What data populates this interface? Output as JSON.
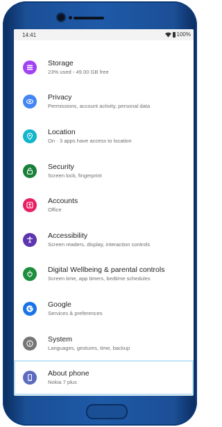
{
  "status_bar": {
    "time": "14:41",
    "battery": "100%"
  },
  "settings": {
    "items": [
      {
        "title": "Storage",
        "subtitle": "23% used - 49.00 GB free",
        "icon": "storage-icon",
        "color": "#a142f4"
      },
      {
        "title": "Privacy",
        "subtitle": "Permissions, account activity, personal data",
        "icon": "privacy-icon",
        "color": "#4285f4"
      },
      {
        "title": "Location",
        "subtitle": "On · 3 apps have access to location",
        "icon": "location-icon",
        "color": "#12b5cb"
      },
      {
        "title": "Security",
        "subtitle": "Screen lock, fingerprint",
        "icon": "lock-icon",
        "color": "#188038"
      },
      {
        "title": "Accounts",
        "subtitle": "Office",
        "icon": "accounts-icon",
        "color": "#e91e63"
      },
      {
        "title": "Accessibility",
        "subtitle": "Screen readers, display, interaction controls",
        "icon": "accessibility-icon",
        "color": "#5e35b1"
      },
      {
        "title": "Digital Wellbeing & parental controls",
        "subtitle": "Screen time, app timers, bedtime schedules",
        "icon": "wellbeing-icon",
        "color": "#1e8e3e"
      },
      {
        "title": "Google",
        "subtitle": "Services & preferences",
        "icon": "google-icon",
        "color": "#1a73e8"
      },
      {
        "title": "System",
        "subtitle": "Languages, gestures, time, backup",
        "icon": "info-icon",
        "color": "#757575"
      },
      {
        "title": "About phone",
        "subtitle": "Nokia 7 plus",
        "icon": "phone-icon",
        "color": "#5c6bc0"
      }
    ]
  }
}
